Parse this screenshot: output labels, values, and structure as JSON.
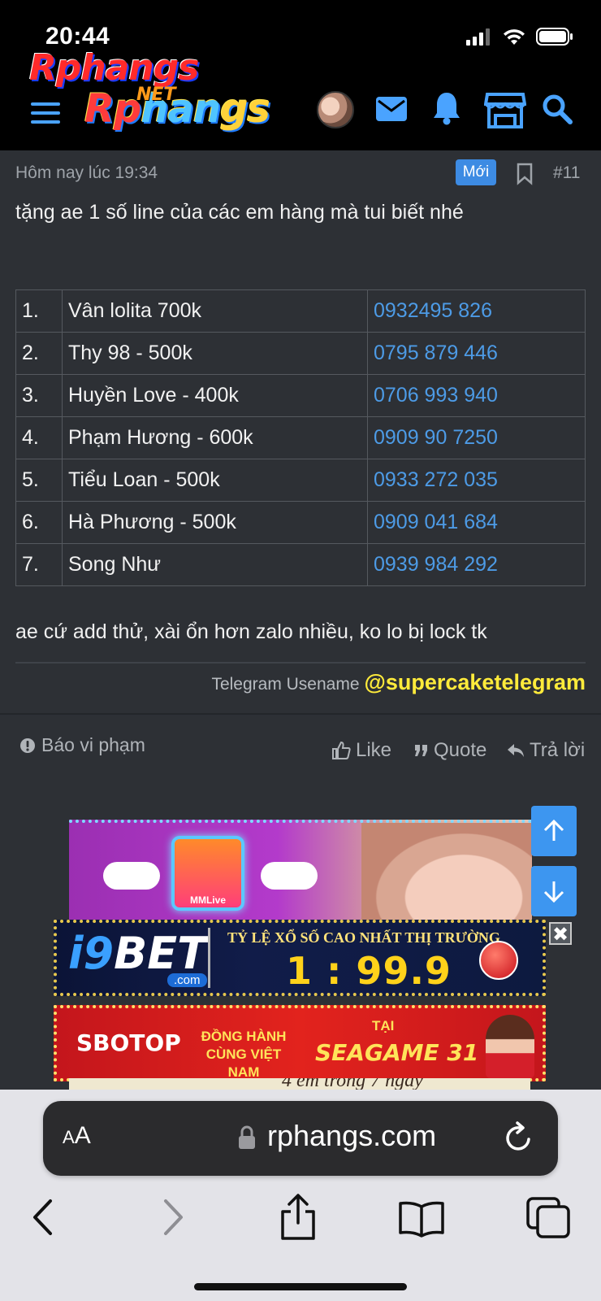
{
  "status_bar": {
    "time": "20:44"
  },
  "header": {
    "logo_top": "Rphangs",
    "logo_net": "NET",
    "logo": {
      "part1": "Rp",
      "part2": "han",
      "part3": "gs"
    },
    "accent_color": "#4aa3ff"
  },
  "post": {
    "timestamp": "Hôm nay lúc 19:34",
    "new_badge": "Mới",
    "post_number": "#11",
    "intro": "tặng ae 1 số line của các em hàng mà tui biết nhé",
    "table_rows": [
      {
        "idx": "1.",
        "name": "Vân lolita 700k",
        "phone": "0932495 826"
      },
      {
        "idx": "2.",
        "name": "Thy 98 - 500k",
        "phone": "0795 879 446"
      },
      {
        "idx": "3.",
        "name": "Huyền Love - 400k",
        "phone": "0706 993 940"
      },
      {
        "idx": "4.",
        "name": "Phạm Hương - 600k",
        "phone": "0909 90 7250"
      },
      {
        "idx": "5.",
        "name": "Tiểu Loan - 500k",
        "phone": "0933 272 035"
      },
      {
        "idx": "6.",
        "name": "Hà Phương - 500k",
        "phone": "0909 041 684"
      },
      {
        "idx": "7.",
        "name": "Song Như",
        "phone": "0939 984 292"
      }
    ],
    "outro": "ae cứ add thử, xài ổn hơn zalo nhiều, ko lo bị lock tk",
    "telegram_label": "Telegram Usename",
    "telegram_handle": "@supercaketelegram",
    "actions": {
      "report": "Báo vi phạm",
      "like": "Like",
      "quote": "Quote",
      "reply": "Trả lời"
    }
  },
  "ads": {
    "live_tile": "MMLive",
    "i9bet": {
      "logo_i9": "i9",
      "logo_bet": "BET",
      "domain": ".com",
      "tagline": "TỶ LỆ XỔ SỐ CAO NHẤT THỊ TRƯỜNG",
      "odds": "1 : 99.9"
    },
    "close_symbol": "✖",
    "sbotop": {
      "brand": "SBOTOP",
      "line1": "ĐỒNG HÀNH CÙNG VIỆT NAM",
      "tai": "TẠI",
      "event": "SEAGAME 31"
    },
    "peek_text": "4 em trong 7 ngày"
  },
  "safari": {
    "aa_label_small": "A",
    "aa_label_big": "A",
    "url": "rphangs.com"
  }
}
